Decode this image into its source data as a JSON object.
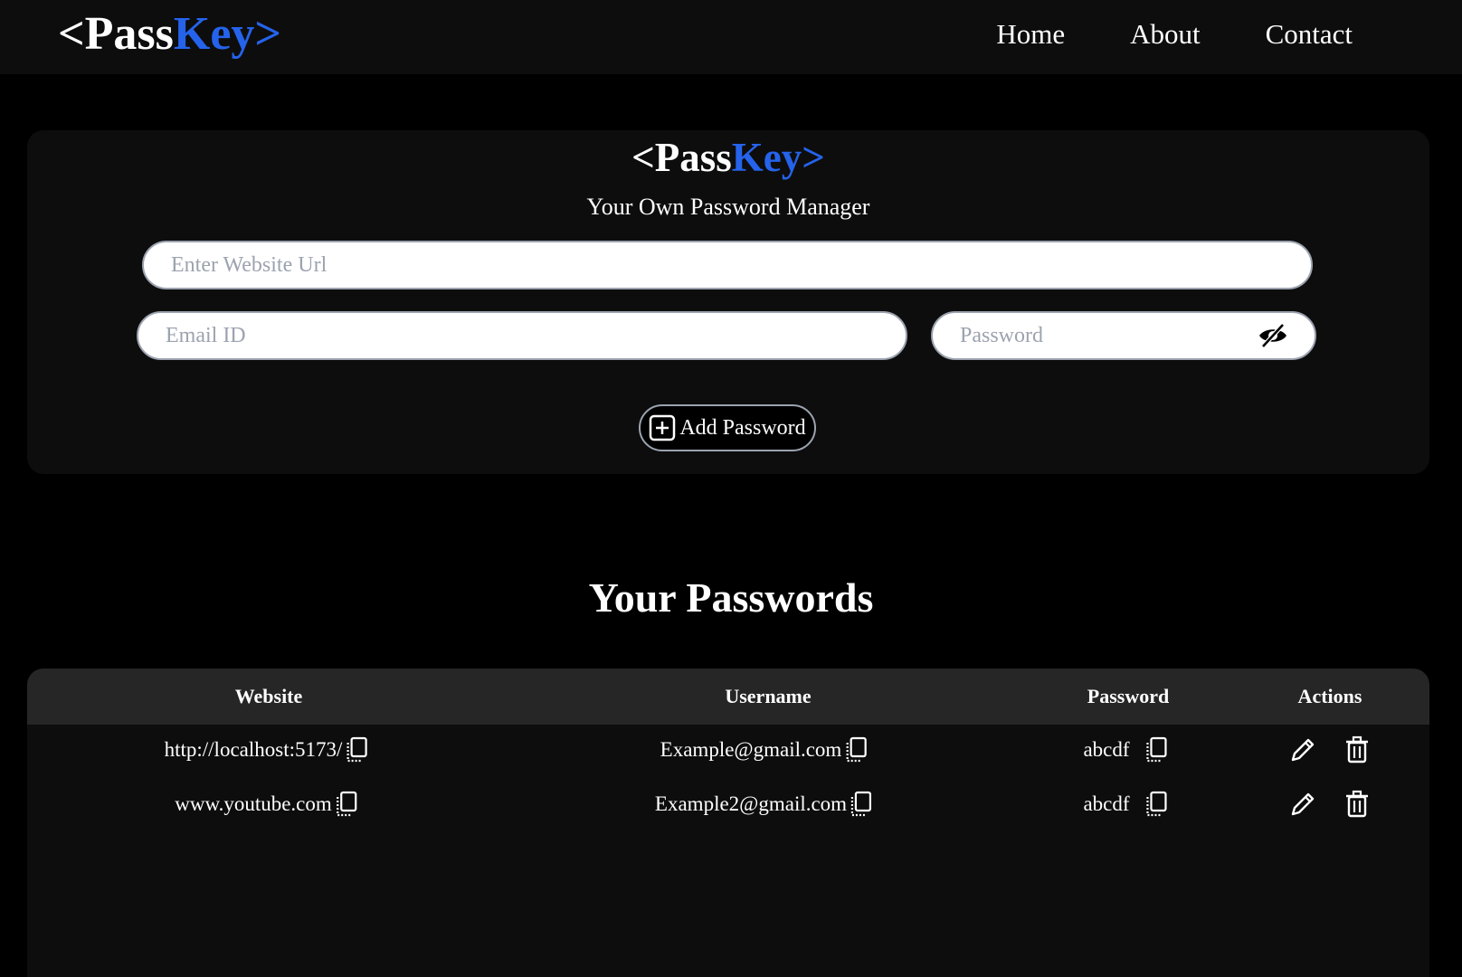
{
  "nav": {
    "logo": {
      "open": "<",
      "pass": "Pass",
      "key": "Key",
      "close": ">"
    },
    "links": [
      "Home",
      "About",
      "Contact"
    ]
  },
  "manager": {
    "logo": {
      "open": "<",
      "pass": "Pass",
      "key": "Key",
      "close": ">"
    },
    "subtitle": "Your Own Password Manager",
    "url_placeholder": "Enter Website Url",
    "email_placeholder": "Email ID",
    "password_placeholder": "Password",
    "add_button": "Add Password"
  },
  "passwords_section": {
    "title": "Your Passwords",
    "columns": [
      "Website",
      "Username",
      "Password",
      "Actions"
    ],
    "rows": [
      {
        "website": "http://localhost:5173/",
        "username": "Example@gmail.com",
        "password": "abcdf"
      },
      {
        "website": "www.youtube.com",
        "username": "Example2@gmail.com",
        "password": "abcdf"
      }
    ]
  },
  "colors": {
    "accent": "#2563eb",
    "background": "#000000",
    "card": "#0d0d0d",
    "table_header": "#262626"
  }
}
